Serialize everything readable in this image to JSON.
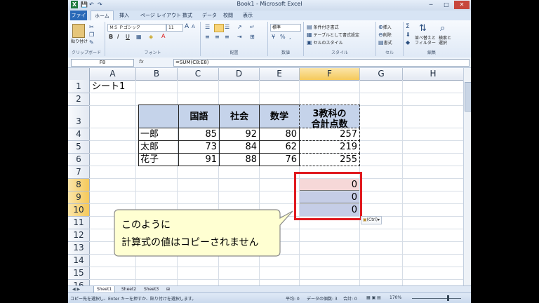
{
  "window": {
    "title": "Book1 - Microsoft Excel",
    "min_glyph": "─",
    "max_glyph": "□",
    "close_glyph": "✕"
  },
  "quick_access": {
    "excel_icon": "X",
    "save_icon": "💾",
    "undo_icon": "↶",
    "redo_icon": "↷"
  },
  "tabs": [
    "ファイル",
    "ホーム",
    "挿入",
    "ページ レイアウト",
    "数式",
    "データ",
    "校閲",
    "表示"
  ],
  "ribbon": {
    "clipboard": {
      "label": "クリップボード",
      "paste": "貼り付け"
    },
    "font": {
      "label": "フォント",
      "font_name": "ＭＳ Ｐゴシック",
      "font_size": "11",
      "grow": "A",
      "shrink": "A",
      "bold": "B",
      "italic": "I",
      "underline": "U"
    },
    "alignment": {
      "label": "配置"
    },
    "number": {
      "label": "数値",
      "format": "標準",
      "percent": "%",
      "comma": ","
    },
    "styles": {
      "label": "スタイル",
      "conditional": "条件付き書式",
      "as_table": "テーブルとして書式設定",
      "cell_styles": "セルのスタイル"
    },
    "cells": {
      "label": "セル",
      "insert": "挿入",
      "delete": "削除",
      "format": "書式"
    },
    "editing": {
      "label": "編集",
      "sort": "並べ替えと\nフィルター",
      "find": "検索と\n選択",
      "sum_icon": "Σ"
    }
  },
  "formula_bar": {
    "name_box": "F8",
    "fx": "fx",
    "formula": "=SUM(C8:E8)"
  },
  "columns": [
    "A",
    "B",
    "C",
    "D",
    "E",
    "F",
    "G",
    "H"
  ],
  "rows": [
    "1",
    "2",
    "3",
    "4",
    "5",
    "6",
    "7",
    "8",
    "9",
    "10",
    "11",
    "12",
    "13",
    "14",
    "15",
    "16"
  ],
  "sheet": {
    "a1": "シート1",
    "headers": [
      "国語",
      "社会",
      "数学"
    ],
    "total_header_1": "3教科の",
    "total_header_2": "合計点数",
    "people": [
      {
        "name": "一郎",
        "kokugo": "85",
        "shakai": "92",
        "sugaku": "80",
        "total": "257"
      },
      {
        "name": "太郎",
        "kokugo": "73",
        "shakai": "84",
        "sugaku": "62",
        "total": "219"
      },
      {
        "name": "花子",
        "kokugo": "91",
        "shakai": "88",
        "sugaku": "76",
        "total": "255"
      }
    ],
    "pasted": [
      "0",
      "0",
      "0"
    ],
    "paste_options": "(Ctrl)"
  },
  "callout": {
    "line1": "このように",
    "line2": "計算式の値はコピーされません"
  },
  "sheet_tabs": [
    "Sheet1",
    "Sheet2",
    "Sheet3"
  ],
  "status": {
    "message": "コピー先を選択し、Enter キーを押すか、貼り付けを選択します。",
    "average": "平均: 0",
    "count": "データの個数: 3",
    "sum": "合計: 0",
    "zoom": "170%"
  },
  "colors": {
    "selection_border": "#e0191e",
    "pink_fill": "#f6d8d8",
    "blue_fill": "#c5cde6",
    "header_fill": "#c5d3ea",
    "callout_fill": "#ffffd2"
  }
}
